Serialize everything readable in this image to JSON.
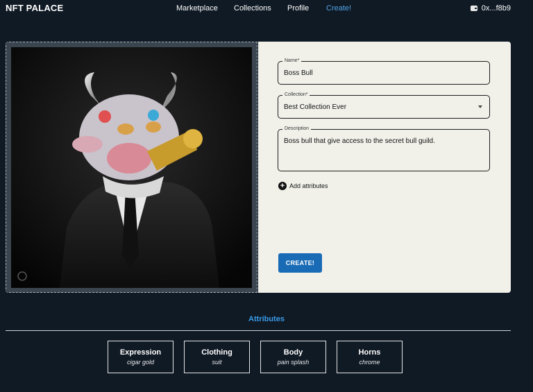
{
  "header": {
    "logo": "NFT PALACE",
    "nav": [
      {
        "label": "Marketplace",
        "active": false
      },
      {
        "label": "Collections",
        "active": false
      },
      {
        "label": "Profile",
        "active": false
      },
      {
        "label": "Create!",
        "active": true
      }
    ],
    "wallet": {
      "icon": "wallet-icon",
      "address": "0x...f8b9"
    }
  },
  "form": {
    "name": {
      "label": "Name",
      "required_mark": "*",
      "value": "Boss Bull"
    },
    "collection": {
      "label": "Collection",
      "required_mark": "*",
      "value": "Best Collection Ever"
    },
    "description": {
      "label": "Description",
      "value": "Boss bull that give access to the secret bull guild."
    },
    "add_attributes_label": "Add attributes",
    "submit_label": "CREATE!"
  },
  "attributes": {
    "heading": "Attributes",
    "items": [
      {
        "trait": "Expression",
        "value": "cigar gold"
      },
      {
        "trait": "Clothing",
        "value": "suit"
      },
      {
        "trait": "Body",
        "value": "pain splash"
      },
      {
        "trait": "Horns",
        "value": "chrome"
      }
    ]
  },
  "colors": {
    "accent": "#3a9be8",
    "button": "#1a6bb5",
    "background": "#101a25",
    "form_bg": "#f1f1ea"
  }
}
